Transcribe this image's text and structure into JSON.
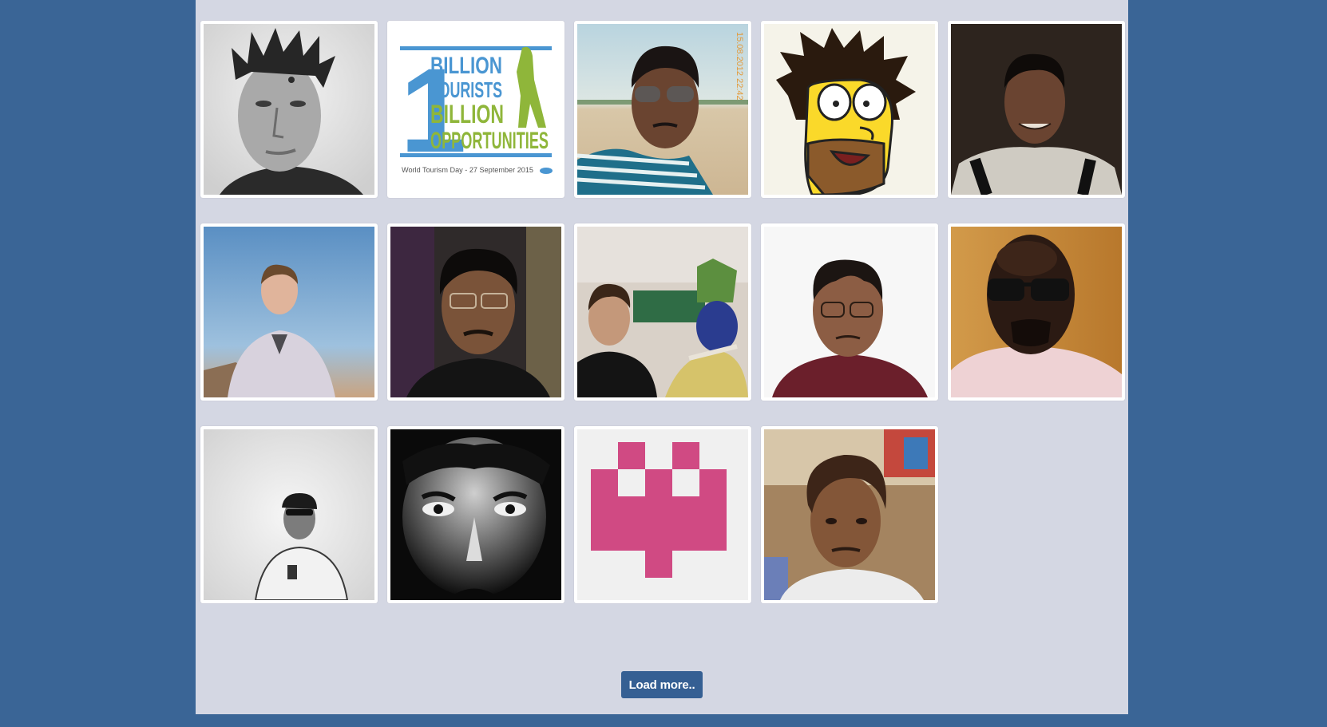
{
  "page": {
    "background_color": "#3a6596",
    "panel_color": "#d4d7e3"
  },
  "avatars": [
    {
      "description": "grayscale portrait of man with spiky hair"
    },
    {
      "description": "1 Billion Tourists Billion Opportunities logo",
      "logo_text_line1": "BILLION",
      "logo_text_line2": "TOURISTS",
      "logo_text_line3": "BILLION",
      "logo_text_line4": "OPPORTUNITIES",
      "logo_caption": "World Tourism Day - 27 September 2015",
      "logo_numeral": "1"
    },
    {
      "description": "man with sunglasses at beach selfie",
      "timestamp": "15.08.2012 22:42"
    },
    {
      "description": "cartoon yellow character with spiky hair"
    },
    {
      "description": "smiling man in dark background"
    },
    {
      "description": "young man against blue sky"
    },
    {
      "description": "man with glasses dark portrait"
    },
    {
      "description": "man next to person with blue face paint"
    },
    {
      "description": "bald man with glasses on white background"
    },
    {
      "description": "bald man with dark sunglasses"
    },
    {
      "description": "man with sunglasses on white background"
    },
    {
      "description": "dramatic black and white face close-up"
    },
    {
      "description": "pink pixel identicon",
      "color": "#d04a83"
    },
    {
      "description": "young man with wavy hair outdoors"
    }
  ],
  "load_more": {
    "label": "Load more.."
  }
}
